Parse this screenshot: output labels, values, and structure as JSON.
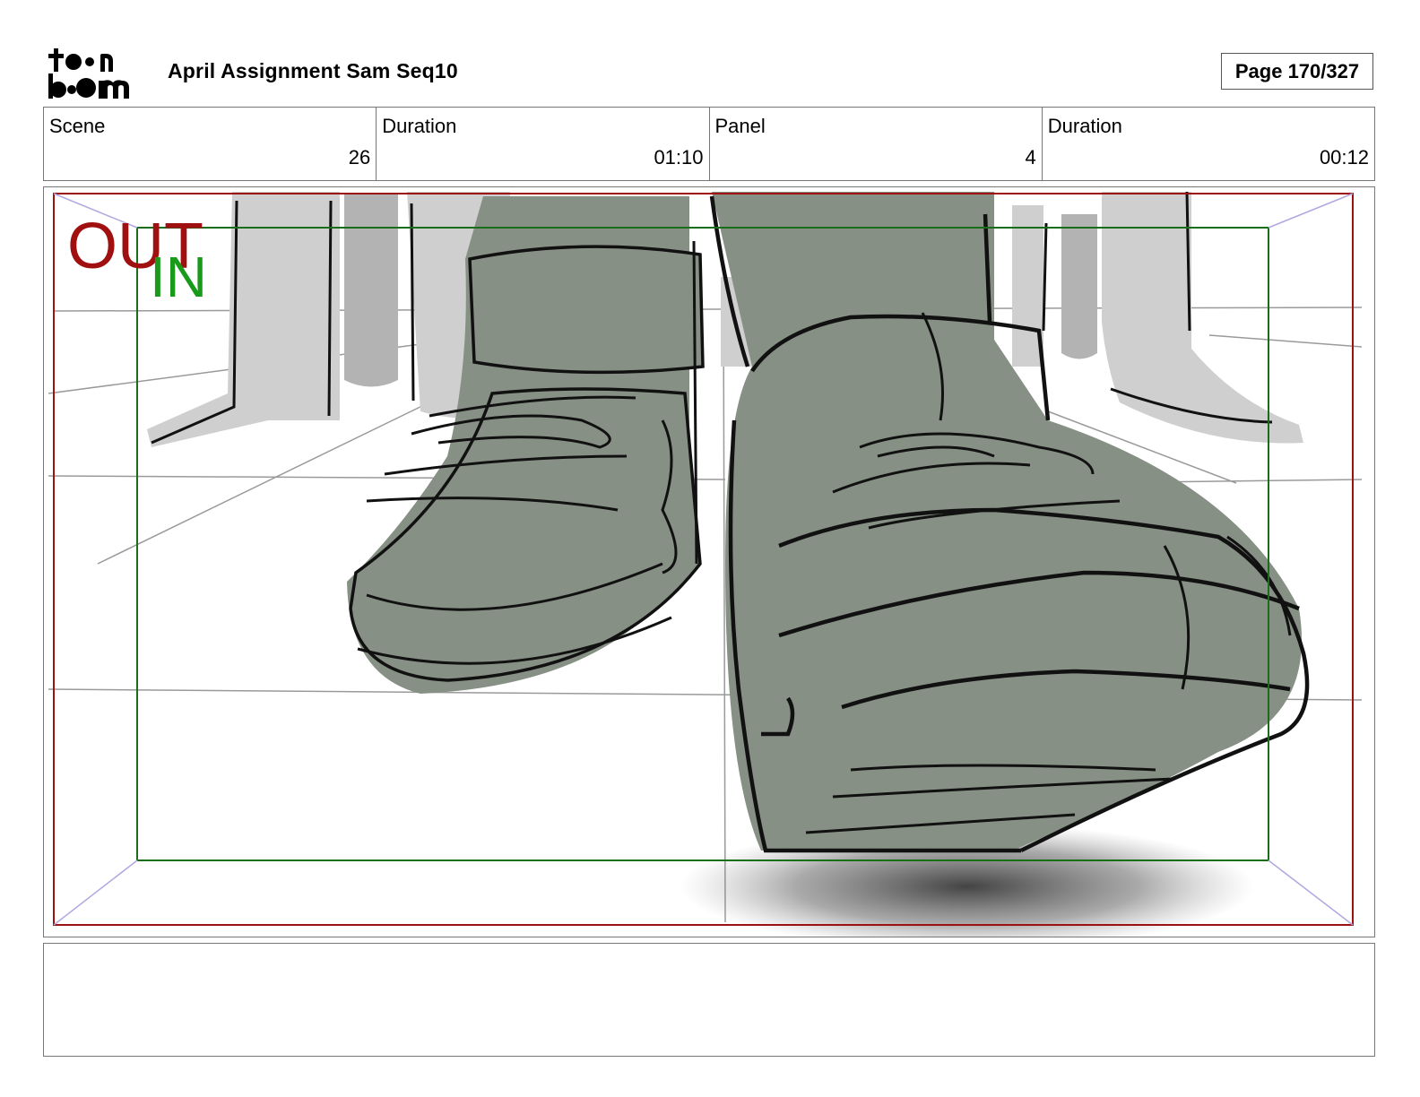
{
  "header": {
    "logo_text": "toon boom",
    "title": "April Assignment Sam Seq10",
    "page_label": "Page 170/327"
  },
  "info": [
    {
      "label": "Scene",
      "value": "26"
    },
    {
      "label": "Duration",
      "value": "01:10"
    },
    {
      "label": "Panel",
      "value": "4"
    },
    {
      "label": "Duration",
      "value": "00:12"
    }
  ],
  "panel": {
    "out_label": "OUT",
    "in_label": "IN",
    "colors": {
      "out_frame": "#a01010",
      "in_frame": "#1a6e1a",
      "shoe_fill": "#879085",
      "background_legs": "#cfcfcf"
    }
  },
  "dialogue": {
    "text": ""
  }
}
